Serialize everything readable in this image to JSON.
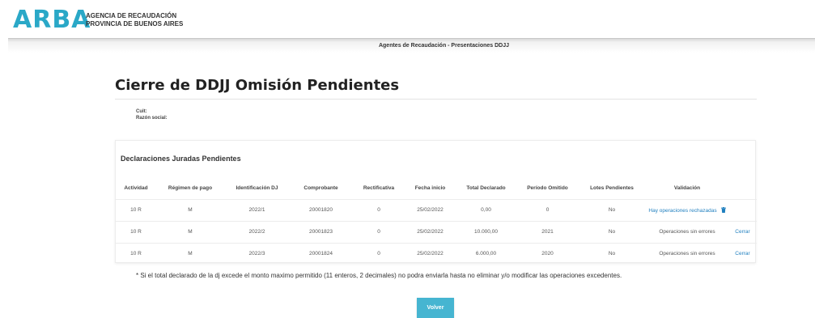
{
  "header": {
    "logo": "ARBA",
    "agency_line1": "AGENCIA DE RECAUDACIÓN",
    "agency_line2": "PROVINCIA DE BUENOS AIRES"
  },
  "subbar": {
    "title": "Agentes de Recaudación - Presentaciones DDJJ"
  },
  "page": {
    "title": "Cierre de DDJJ Omisión Pendientes",
    "cuit_label": "Cuit:",
    "razon_label": "Razón social:"
  },
  "panel": {
    "title": "Declaraciones Juradas Pendientes",
    "columns": [
      "Actividad",
      "Régimen de pago",
      "Identificación DJ",
      "Comprobante",
      "Rectificativa",
      "Fecha inicio",
      "Total Declarado",
      "Período Omitido",
      "Lotes Pendientes",
      "Validación",
      ""
    ],
    "rows": [
      [
        "10 R",
        "M",
        "2022/1",
        "20001820",
        "0",
        "25/02/2022",
        "0,00",
        "0",
        "No",
        "Hay operaciones rechazadas",
        ""
      ],
      [
        "10 R",
        "M",
        "2022/2",
        "20001823",
        "0",
        "25/02/2022",
        "10.000,00",
        "2021",
        "No",
        "Operaciones sin errores",
        "Cerrar"
      ],
      [
        "10 R",
        "M",
        "2022/3",
        "20001824",
        "0",
        "25/02/2022",
        "6.000,00",
        "2020",
        "No",
        "Operaciones sin errores",
        "Cerrar"
      ]
    ]
  },
  "footnote": "* Si el total declarado de la dj excede el monto maximo permitido (11 enteros, 2 decimales) no podra enviarla hasta no eliminar y/o modificar las operaciones excedentes.",
  "actions": {
    "back_label": "Volver"
  },
  "colors": {
    "brand": "#2aa8c7",
    "button": "#46b5d1",
    "link": "#1f7fbf"
  }
}
